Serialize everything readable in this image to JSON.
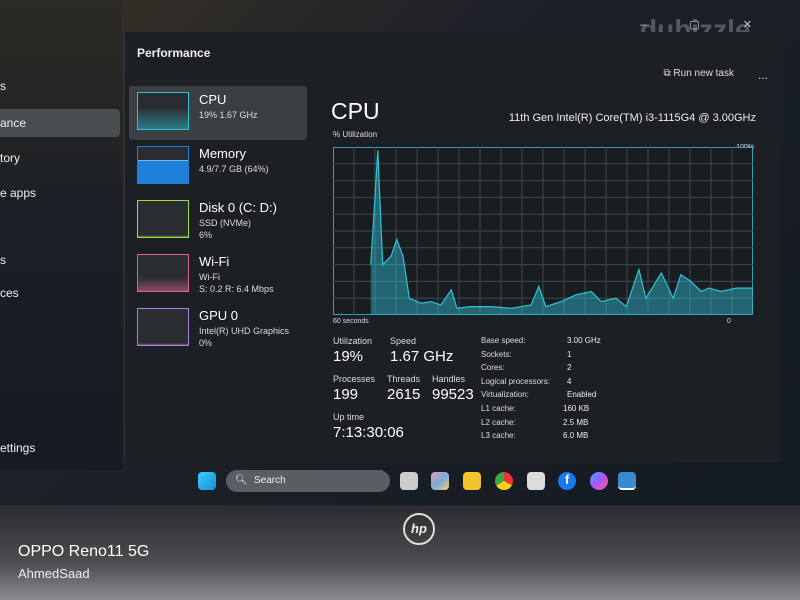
{
  "watermarks": {
    "site": "dubizzle",
    "camera": "OPPO Reno11 5G",
    "user": "AhmedSaad"
  },
  "nav": {
    "items": [
      {
        "label": "s"
      },
      {
        "label": "ance",
        "selected": true
      },
      {
        "label": "tory"
      },
      {
        "label": "e apps"
      },
      {
        "label": "s"
      },
      {
        "label": "ces"
      }
    ],
    "settings": "ettings"
  },
  "window": {
    "title": "Performance",
    "run_new_task": "Run new task",
    "more": "...",
    "controls": "– ▢ ✕"
  },
  "resources": [
    {
      "name": "CPU",
      "sub1": "19% 1.67 GHz",
      "sub2": "",
      "selected": true,
      "color": "#2fc2d8"
    },
    {
      "name": "Memory",
      "sub1": "4.9/7.7 GB (64%)",
      "sub2": "",
      "color": "#1e7fd8",
      "fill": 64
    },
    {
      "name": "Disk 0 (C: D:)",
      "sub1": "SSD (NVMe)",
      "sub2": "6%",
      "color": "#9bd84a"
    },
    {
      "name": "Wi-Fi",
      "sub1": "Wi-Fi",
      "sub2": "S: 0.2 R: 6.4 Mbps",
      "color": "#e0609a"
    },
    {
      "name": "GPU 0",
      "sub1": "Intel(R) UHD Graphics",
      "sub2": "0%",
      "color": "#b080e0"
    }
  ],
  "cpu": {
    "title": "CPU",
    "model": "11th Gen Intel(R) Core(TM) i3-1115G4 @ 3.00GHz",
    "graph_label": "% Utilization",
    "max_label": "100%",
    "left_label": "60 seconds",
    "right_label": "0",
    "history": {
      "x_unit": "seconds ago",
      "y_unit": "%",
      "points": [
        [
          54.6,
          30
        ],
        [
          53.6,
          98
        ],
        [
          52.9,
          30
        ],
        [
          51.7,
          35
        ],
        [
          50.9,
          45
        ],
        [
          50,
          35
        ],
        [
          49.1,
          10
        ],
        [
          47.4,
          7
        ],
        [
          46,
          8
        ],
        [
          44.6,
          6
        ],
        [
          43.1,
          15
        ],
        [
          42.3,
          4
        ],
        [
          40.3,
          5
        ],
        [
          37.4,
          5
        ],
        [
          34.6,
          4
        ],
        [
          31.7,
          6
        ],
        [
          30.6,
          17
        ],
        [
          29.6,
          5
        ],
        [
          27.4,
          8
        ],
        [
          25.3,
          12
        ],
        [
          23.1,
          14
        ],
        [
          21.7,
          8
        ],
        [
          19.6,
          10
        ],
        [
          18.1,
          5
        ],
        [
          16.3,
          27
        ],
        [
          15.3,
          10
        ],
        [
          13.1,
          25
        ],
        [
          11.4,
          10
        ],
        [
          10.3,
          24
        ],
        [
          8.9,
          20
        ],
        [
          7.4,
          14
        ],
        [
          6.3,
          16
        ],
        [
          4.6,
          14
        ],
        [
          2.4,
          16
        ],
        [
          0,
          16
        ]
      ]
    },
    "stats": {
      "utilization_label": "Utilization",
      "utilization": "19%",
      "speed_label": "Speed",
      "speed": "1.67 GHz",
      "processes_label": "Processes",
      "processes": "199",
      "threads_label": "Threads",
      "threads": "2615",
      "handles_label": "Handles",
      "handles": "99523",
      "uptime_label": "Up time",
      "uptime": "7:13:30:06"
    },
    "specs": [
      {
        "k": "Base speed:",
        "v": "3.00 GHz"
      },
      {
        "k": "Sockets:",
        "v": "1"
      },
      {
        "k": "Cores:",
        "v": "2"
      },
      {
        "k": "Logical processors:",
        "v": "4"
      },
      {
        "k": "Virtualization:",
        "v": "Enabled"
      },
      {
        "k": "L1 cache:",
        "v": "160 KB"
      },
      {
        "k": "L2 cache:",
        "v": "2.5 MB"
      },
      {
        "k": "L3 cache:",
        "v": "6.0 MB"
      }
    ]
  },
  "taskbar": {
    "search": "Search",
    "icons": [
      "task-view",
      "copilot",
      "file-explorer",
      "chrome",
      "store",
      "facebook",
      "messenger",
      "task-manager"
    ]
  },
  "laptop": {
    "logo": "hp"
  }
}
